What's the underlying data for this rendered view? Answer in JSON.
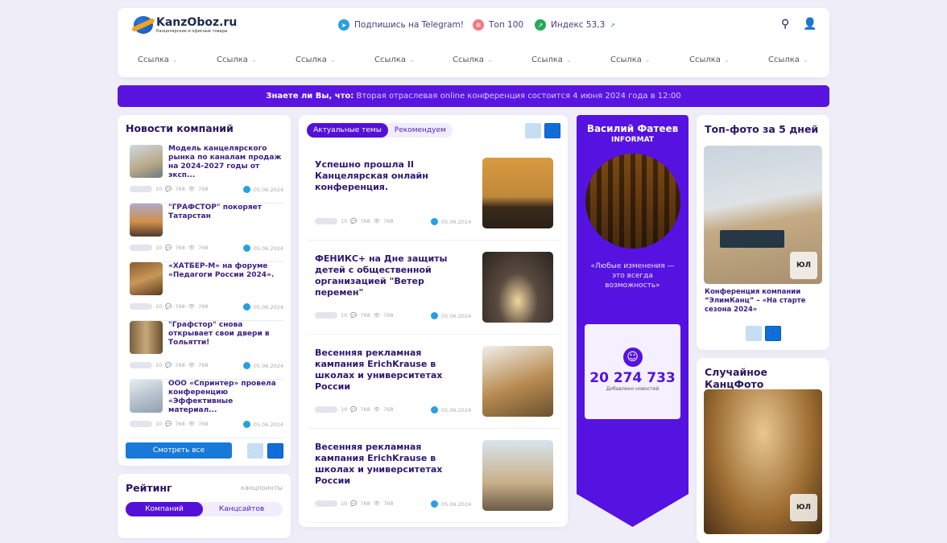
{
  "header": {
    "logo_name": "KanzOboz.ru",
    "logo_tagline": "Канцелярские и офисные товары",
    "telegram": "Подпишись на Telegram!",
    "top100": "Топ 100",
    "index": "Индекс 53,3",
    "nav": [
      "Ссылка",
      "Ссылка",
      "Ссылка",
      "Ссылка",
      "Ссылка",
      "Ссылка",
      "Ссылка",
      "Ссылка",
      "Ссылка"
    ]
  },
  "banner": {
    "lead": "Знаете ли Вы, что:",
    "text": "Вторая отраслевая online конференция состоится 4 июня 2024 года в 12:00"
  },
  "company_news": {
    "title": "Новости компаний",
    "items": [
      {
        "title": "Модель канцелярского рынка по каналам продаж на 2024-2027 годы от эксп...",
        "likes": "10",
        "comments": "768",
        "views": "768",
        "date": "05.06.2024"
      },
      {
        "title": "\"ГРАФСТОР\" покоряет Татарстан",
        "likes": "10",
        "comments": "768",
        "views": "768",
        "date": "05.06.2024"
      },
      {
        "title": "«ХАТБЕР-М» на форуме «Педагоги России 2024».",
        "likes": "10",
        "comments": "768",
        "views": "768",
        "date": "05.06.2024"
      },
      {
        "title": "\"Графстор\" снова открывает свои двери в Тольятти!",
        "likes": "10",
        "comments": "768",
        "views": "768",
        "date": "05.06.2024"
      },
      {
        "title": "ООО «Спринтер» провела конференцию «Эффективные материал...",
        "likes": "10",
        "comments": "768",
        "views": "768",
        "date": "05.06.2024"
      }
    ],
    "see_all": "Смотреть все"
  },
  "rating": {
    "title": "Рейтинг",
    "unit": "канцпоинты",
    "tabs": [
      "Компаний",
      "Канцсайтов"
    ]
  },
  "topics": {
    "tabs": [
      "Актуальные темы",
      "Рекомендуем"
    ],
    "items": [
      {
        "title": "Успешно прошла II Канцелярская онлайн конференция.",
        "likes": "10",
        "comments": "768",
        "views": "768",
        "date": "05.06.2024"
      },
      {
        "title": "ФЕНИКС+ на Дне защиты детей с общественной организацией \"Ветер перемен\"",
        "likes": "10",
        "comments": "768",
        "views": "768",
        "date": "05.06.2024"
      },
      {
        "title": "Весенняя рекламная кампания ErichKrause в школах и университетах России",
        "likes": "10",
        "comments": "768",
        "views": "768",
        "date": "05.06.2024"
      },
      {
        "title": "Весенняя рекламная кампания ErichKrause в школах и университетах России",
        "likes": "10",
        "comments": "768",
        "views": "768",
        "date": "05.06.2024"
      }
    ]
  },
  "author": {
    "name": "Василий Фатеев",
    "company": "INFORMAT",
    "quote": "«Любые изменения — это всегда возможность»",
    "count": "20 274 733",
    "count_label": "Добавлено новостей"
  },
  "top_photo": {
    "title": "Топ-фото за 5 дней",
    "caption": "Конференция компании “ЭлимКанц” – «На старте сезона 2024»",
    "badge": "logo-badge"
  },
  "random_photo": {
    "title": "Случайное КанцФото"
  },
  "colors": {
    "accent": "#5512e0",
    "blue": "#1879d8",
    "bg": "#efeef8"
  }
}
